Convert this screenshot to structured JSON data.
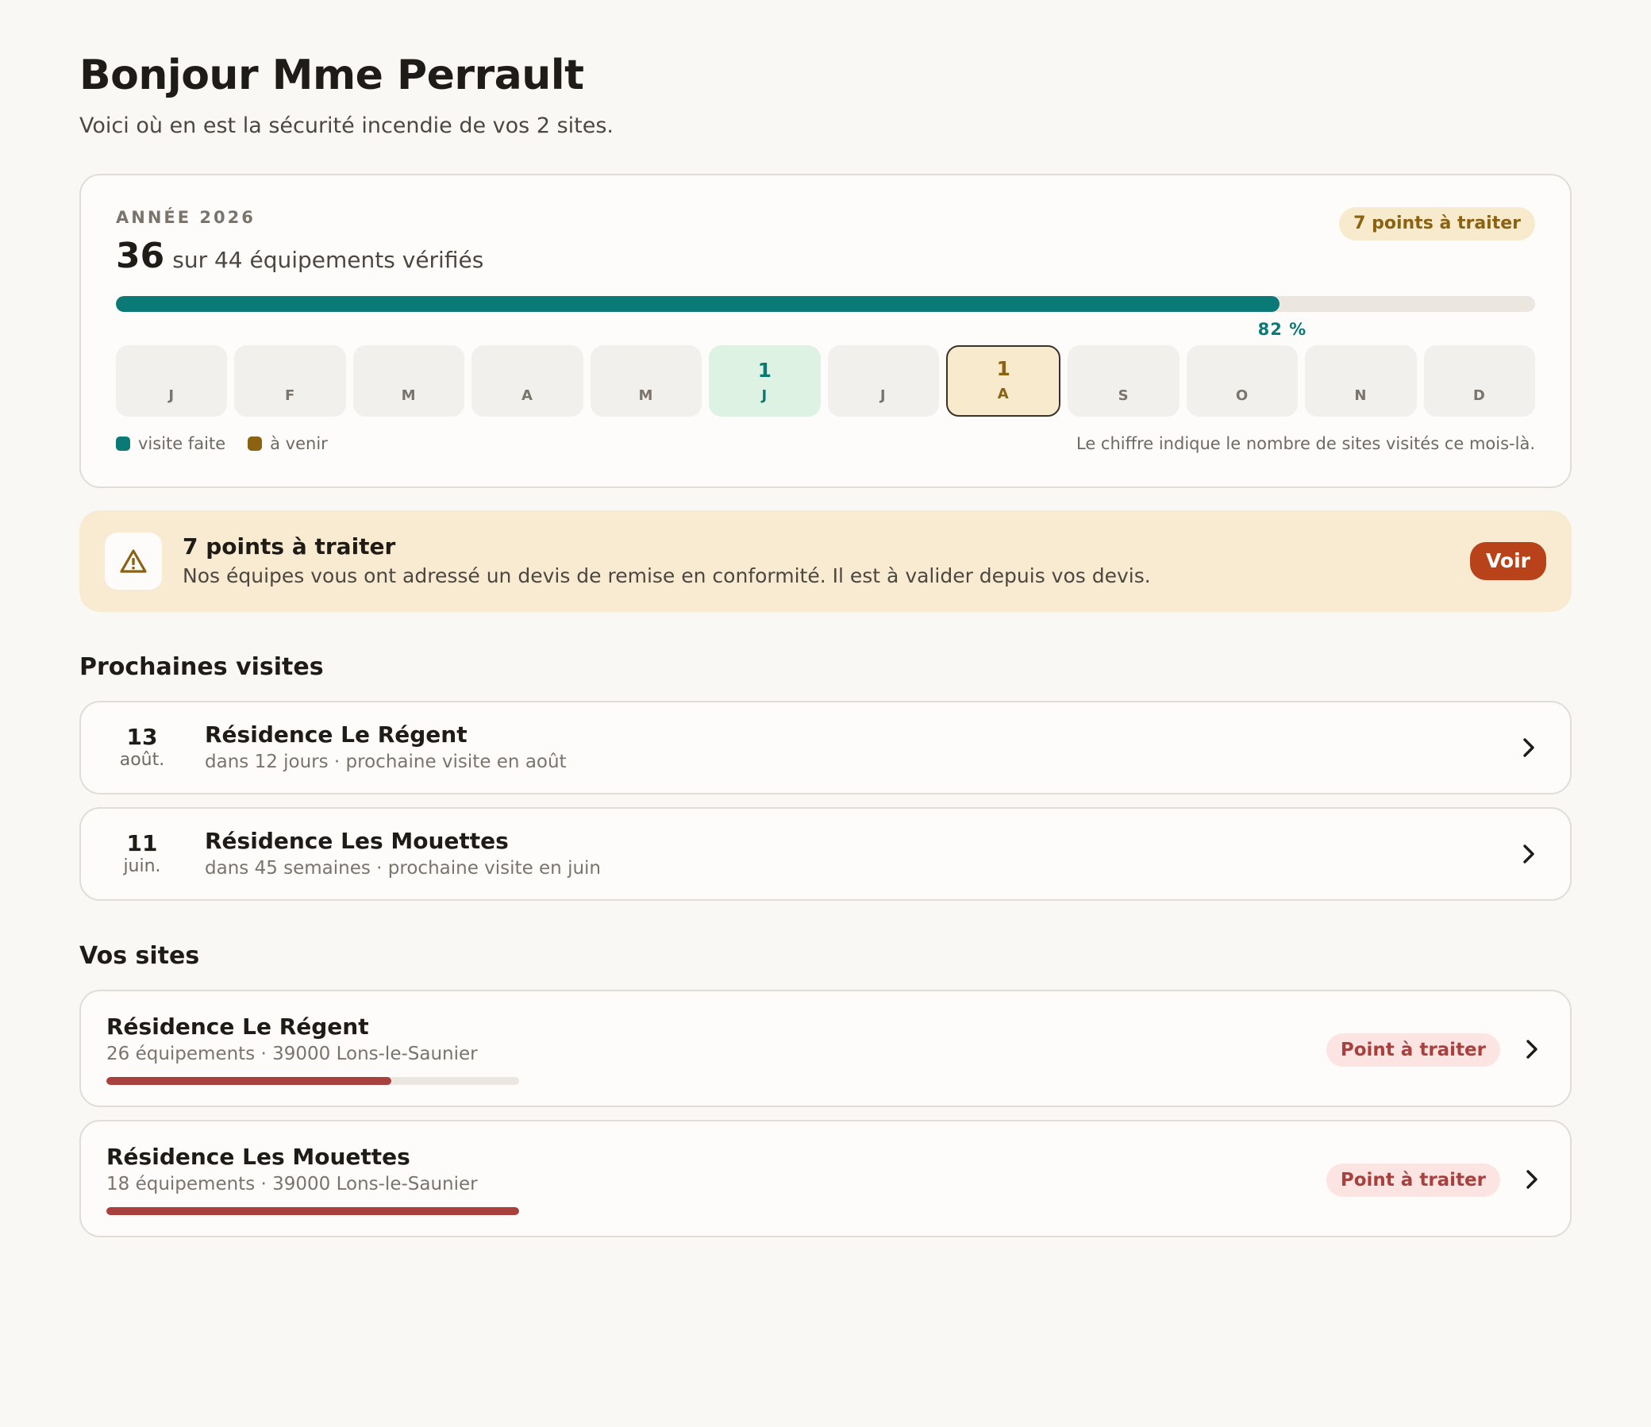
{
  "header": {
    "greeting": "Bonjour Mme Perrault",
    "subtitle": "Voici où en est la sécurité incendie de vos 2 sites."
  },
  "year_card": {
    "label": "ANNÉE 2026",
    "verified_count": "36",
    "verified_text": "sur 44 équipements vérifiés",
    "todo_badge": "7 points à traiter",
    "progress": 0.82,
    "progress_label": "82 %",
    "months": [
      {
        "letter": "J",
        "count": "",
        "state": "none"
      },
      {
        "letter": "F",
        "count": "",
        "state": "none"
      },
      {
        "letter": "M",
        "count": "",
        "state": "none"
      },
      {
        "letter": "A",
        "count": "",
        "state": "none"
      },
      {
        "letter": "M",
        "count": "",
        "state": "none"
      },
      {
        "letter": "J",
        "count": "1",
        "state": "done"
      },
      {
        "letter": "J",
        "count": "",
        "state": "none"
      },
      {
        "letter": "A",
        "count": "1",
        "state": "upcoming"
      },
      {
        "letter": "S",
        "count": "",
        "state": "none"
      },
      {
        "letter": "O",
        "count": "",
        "state": "none"
      },
      {
        "letter": "N",
        "count": "",
        "state": "none"
      },
      {
        "letter": "D",
        "count": "",
        "state": "none"
      }
    ],
    "legend": {
      "done": "visite faite",
      "upcoming": "à venir",
      "note": "Le chiffre indique le nombre de sites visités ce mois-là."
    }
  },
  "alert": {
    "icon": "warning-icon",
    "title": "7 points à traiter",
    "text": "Nos équipes vous ont adressé un devis de remise en conformité. Il est à valider depuis vos devis.",
    "button": "Voir"
  },
  "visits": {
    "title": "Prochaines visites",
    "items": [
      {
        "day": "13",
        "month": "août.",
        "name": "Résidence Le Régent",
        "meta": "dans 12 jours · prochaine visite en août"
      },
      {
        "day": "11",
        "month": "juin.",
        "name": "Résidence Les Mouettes",
        "meta": "dans 45 semaines · prochaine visite en juin"
      }
    ]
  },
  "sites": {
    "title": "Vos sites",
    "items": [
      {
        "name": "Résidence Le Régent",
        "meta": "26 équipements · 39000 Lons-le-Saunier",
        "status": "Point à traiter",
        "progress": 0.69
      },
      {
        "name": "Résidence Les Mouettes",
        "meta": "18 équipements · 39000 Lons-le-Saunier",
        "status": "Point à traiter",
        "progress": 1.0
      }
    ]
  },
  "colors": {
    "accent_teal": "#0b7a77",
    "warning_amber": "#8b6212",
    "danger_red": "#a8403d",
    "button_orange": "#b8431b"
  }
}
